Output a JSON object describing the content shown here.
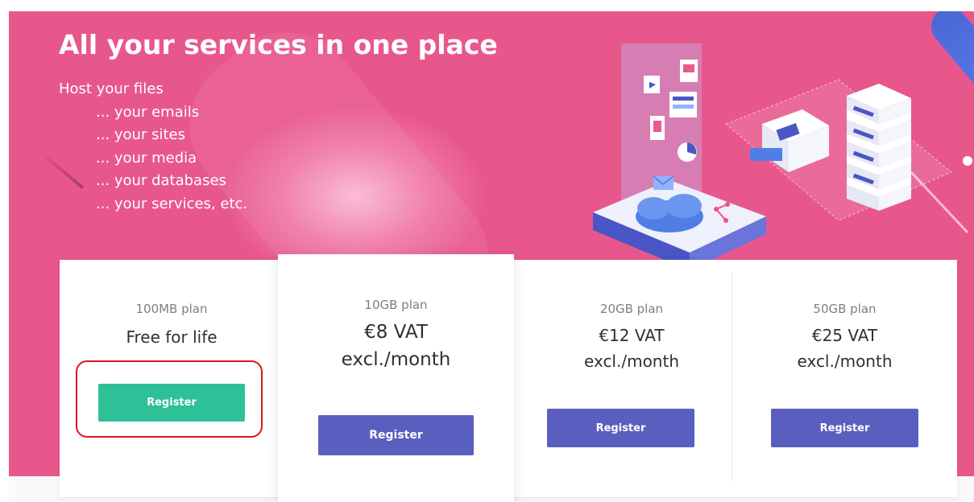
{
  "hero": {
    "title": "All your services in one place",
    "lines": [
      "Host your files",
      "... your emails",
      "... your sites",
      "... your media",
      "... your databases",
      "... your services, etc."
    ],
    "background_color": "#e8578b"
  },
  "plans": [
    {
      "name": "100MB plan",
      "price_line1": "Free for life",
      "price_line2": "",
      "button_label": "Register",
      "button_color": "#2ec096",
      "highlighted": true
    },
    {
      "name": "10GB plan",
      "price_line1": "€8 VAT",
      "price_line2": "excl./month",
      "button_label": "Register",
      "button_color": "#5a5fbf",
      "highlighted": false
    },
    {
      "name": "20GB plan",
      "price_line1": "€12 VAT",
      "price_line2": "excl./month",
      "button_label": "Register",
      "button_color": "#5a5fbf",
      "highlighted": false
    },
    {
      "name": "50GB plan",
      "price_line1": "€25 VAT",
      "price_line2": "excl./month",
      "button_label": "Register",
      "button_color": "#5a5fbf",
      "highlighted": false
    }
  ],
  "annotation_color": "#e0151b"
}
